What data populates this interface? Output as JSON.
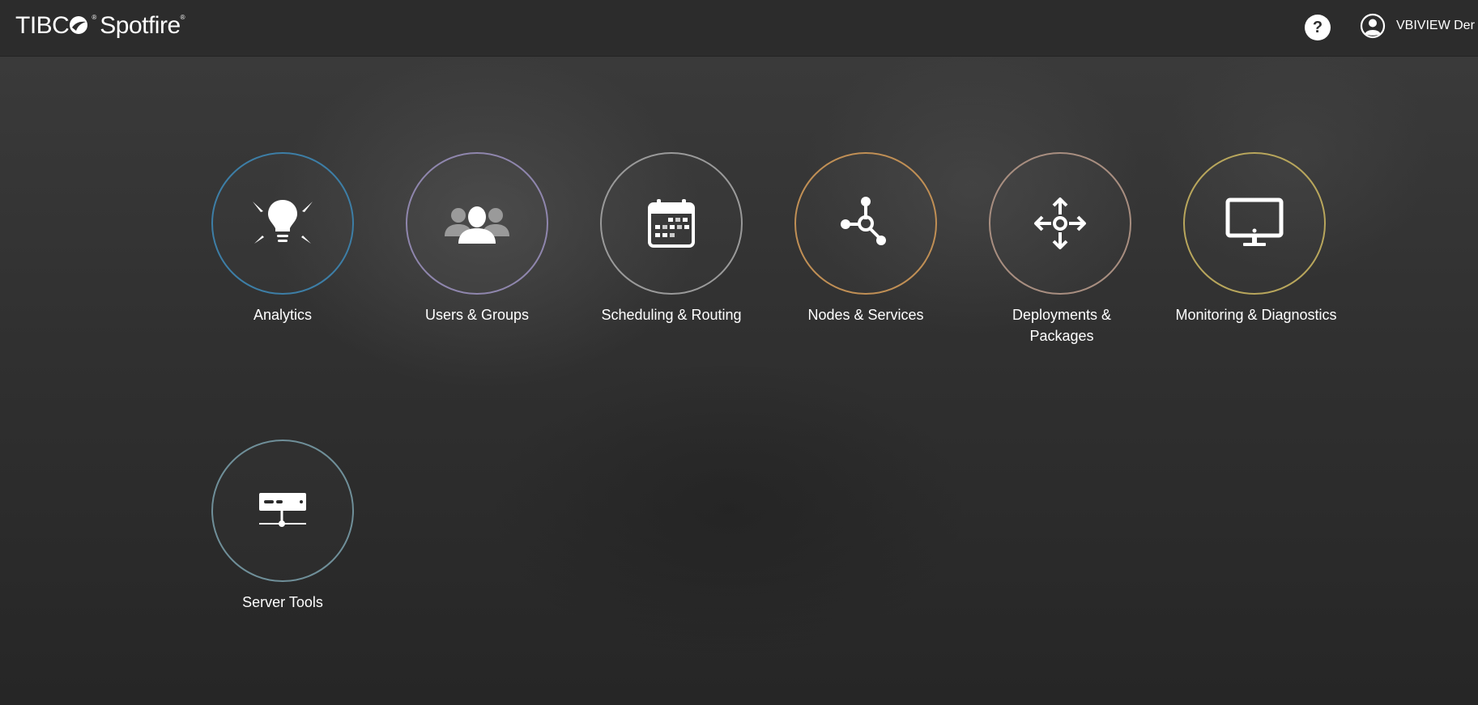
{
  "header": {
    "logo": {
      "brand_left": "TIBC",
      "brand_right": "Spotfire",
      "reg_mark": "®"
    },
    "help": {
      "icon": "help-icon",
      "label": "?"
    },
    "user": {
      "icon": "user-avatar-icon",
      "name": "VBIVIEW Der"
    }
  },
  "tiles": [
    {
      "label": "Analytics",
      "icon": "lightbulb-icon",
      "ring_color": "#3d7ea6"
    },
    {
      "label": "Users & Groups",
      "icon": "users-group-icon",
      "ring_color": "#8f86ad"
    },
    {
      "label": "Scheduling & Routing",
      "icon": "calendar-icon",
      "ring_color": "#9a9a9a"
    },
    {
      "label": "Nodes & Services",
      "icon": "nodes-icon",
      "ring_color": "#c08f55"
    },
    {
      "label": "Deployments & Packages",
      "icon": "move-arrows-icon",
      "ring_color": "#a88e80"
    },
    {
      "label": "Monitoring & Diagnostics",
      "icon": "monitor-icon",
      "ring_color": "#b8a65c"
    },
    {
      "label": "Server Tools",
      "icon": "server-icon",
      "ring_color": "#6f8f99"
    }
  ]
}
